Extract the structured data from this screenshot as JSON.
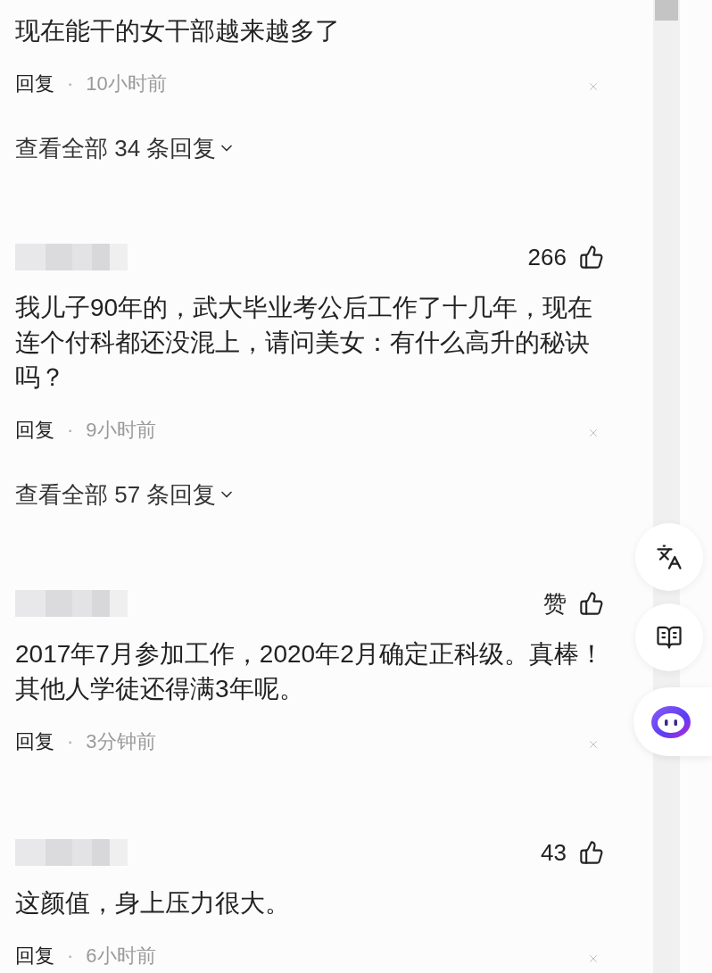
{
  "comments": [
    {
      "text": "现在能干的女干部越来越多了",
      "reply": "回复",
      "dot": "·",
      "time": "10小时前",
      "view_replies": "查看全部 34 条回复"
    },
    {
      "likes": "266",
      "text": "我儿子90年的，武大毕业考公后工作了十几年，现在连个付科都还没混上，请问美女：有什么高升的秘诀吗？",
      "reply": "回复",
      "dot": "·",
      "time": "9小时前",
      "view_replies": "查看全部 57 条回复"
    },
    {
      "likes": "赞",
      "text": "2017年7月参加工作，2020年2月确定正科级。真棒！其他人学徒还得满3年呢。",
      "reply": "回复",
      "dot": "·",
      "time": "3分钟前"
    },
    {
      "likes": "43",
      "text": "这颜值，身上压力很大。",
      "reply": "回复",
      "dot": "·",
      "time": "6小时前"
    }
  ]
}
